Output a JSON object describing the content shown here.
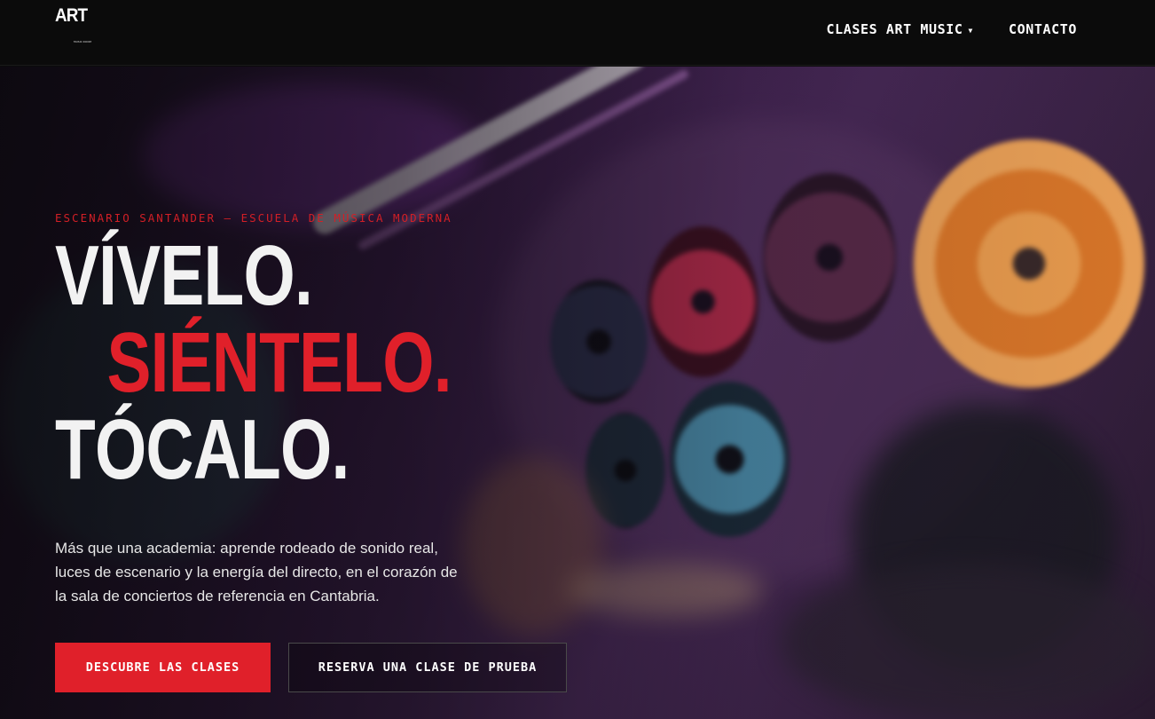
{
  "header": {
    "logo": {
      "main": "ART",
      "sub": "MUSIC ROOM"
    },
    "nav": [
      {
        "label": "CLASES ART MUSIC",
        "has_dropdown": true
      },
      {
        "label": "CONTACTO",
        "has_dropdown": false
      }
    ]
  },
  "hero": {
    "eyebrow": "ESCENARIO SANTANDER — ESCUELA DE MÚSICA MODERNA",
    "headline": [
      "VÍVELO.",
      "SIÉNTELO.",
      "TÓCALO."
    ],
    "description": "Más que una academia: aprende rodeado de sonido real, luces de escenario y la energía del directo, en el corazón de la sala de conciertos de referencia en Cantabria.",
    "primary_button": "DESCUBRE LAS CLASES",
    "secondary_button": "RESERVA UNA CLASE DE PRUEBA"
  },
  "colors": {
    "accent": "#e0202a",
    "header_bg": "#0b0b0b",
    "text": "#ffffff"
  },
  "icons": {
    "dropdown": "chevron-down-icon"
  }
}
